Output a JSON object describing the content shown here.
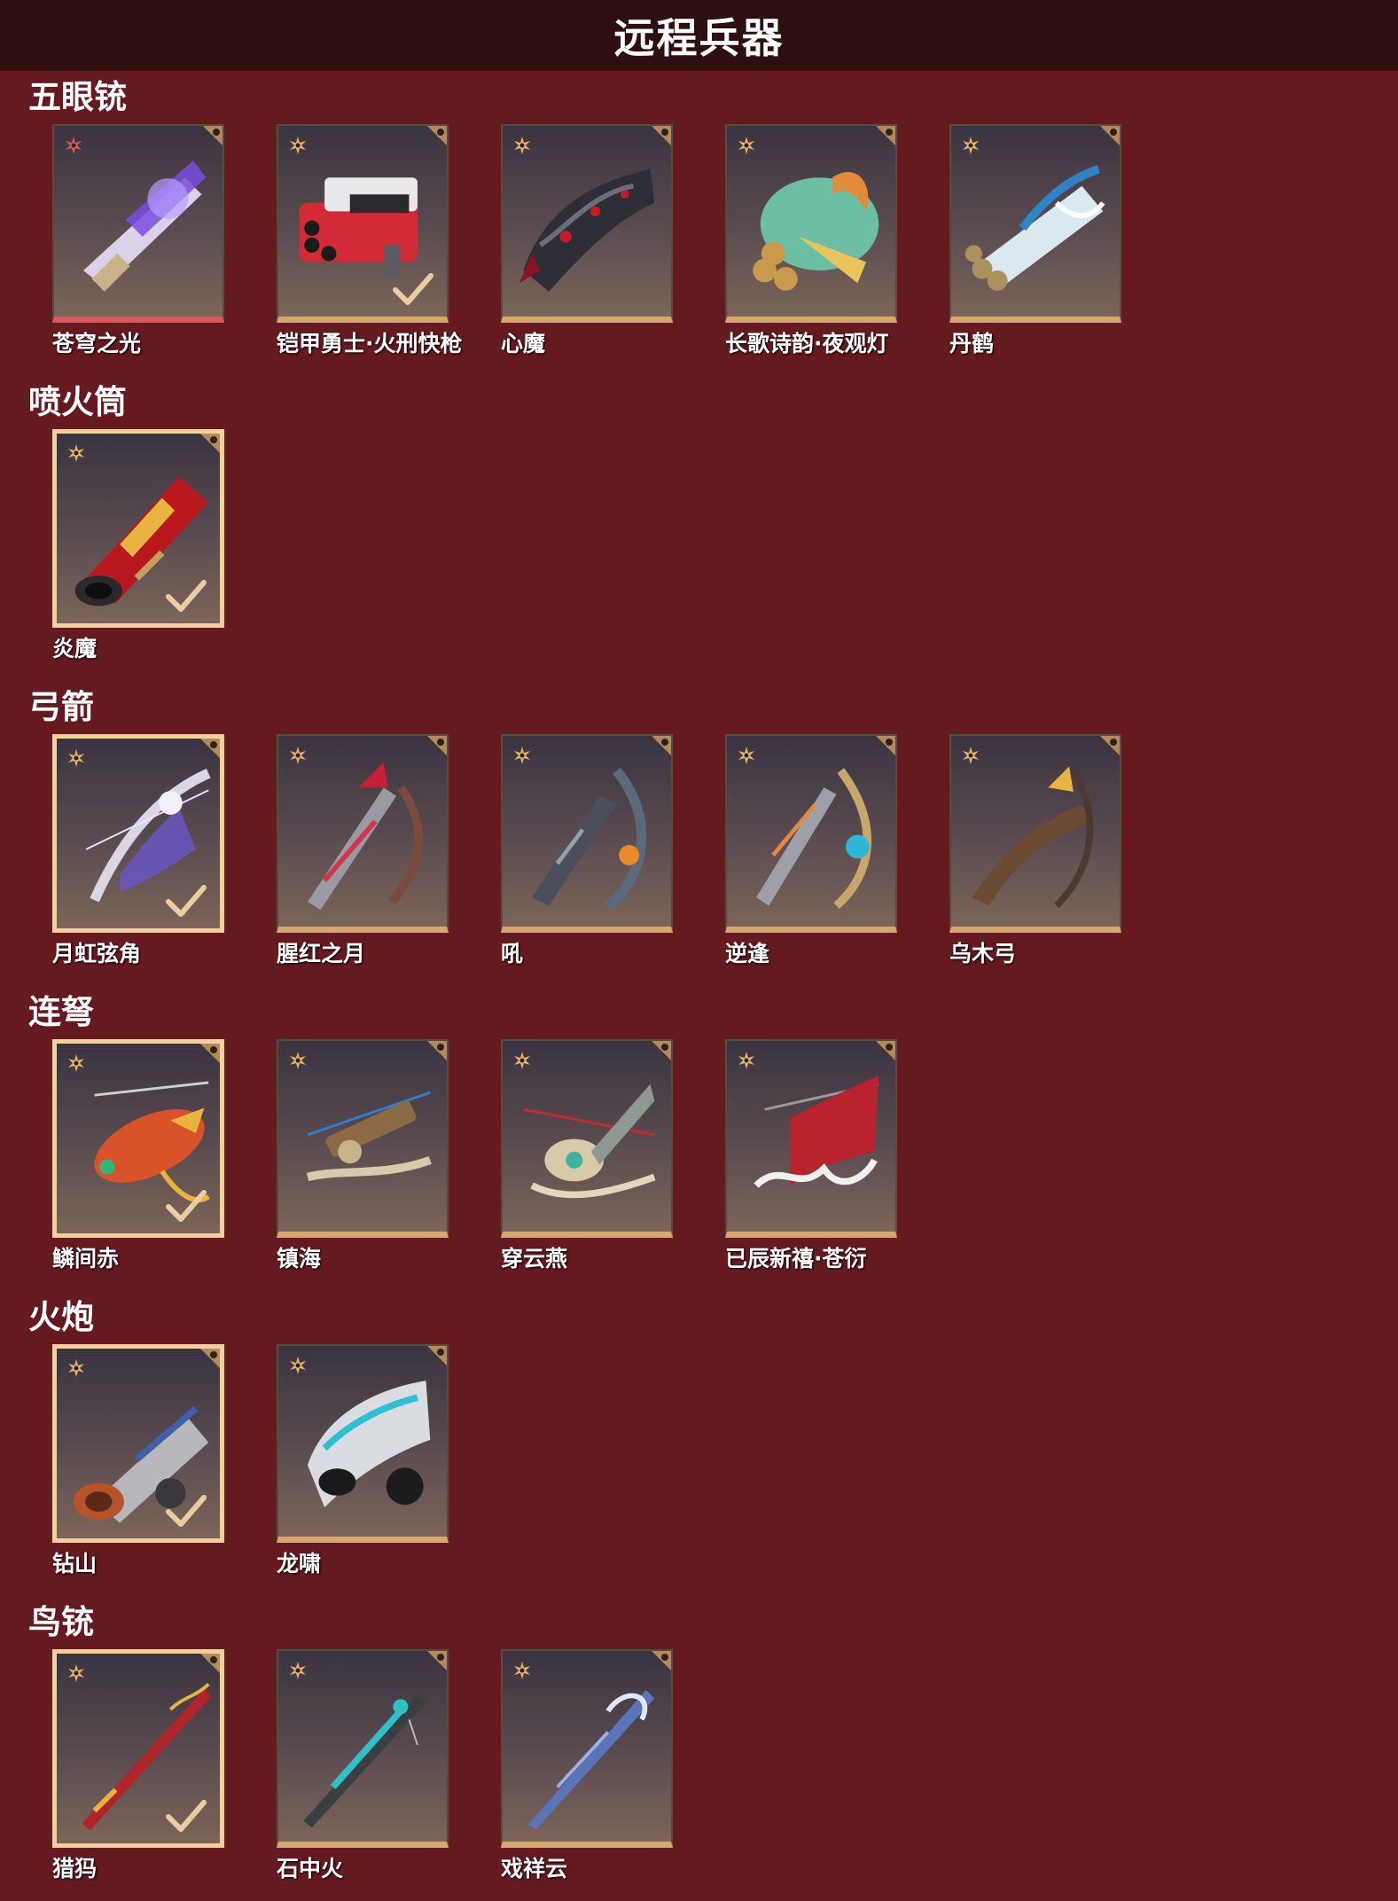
{
  "page_title": "远程兵器",
  "colors": {
    "background": "#641a1f",
    "header": "#2e0f10",
    "card_border_gold": "#d6a86d",
    "selected_border": "#f1d09e",
    "rarity_red": "#e1555f"
  },
  "sections": [
    {
      "title": "五眼铳",
      "items": [
        {
          "name": "苍穹之光",
          "selected": false,
          "rarity": "red",
          "checked": false,
          "art": "ornate-pistol-violet"
        },
        {
          "name": "铠甲勇士·火刑快枪",
          "selected": false,
          "rarity": "gold",
          "checked": true,
          "art": "red-multi-barrel-gun"
        },
        {
          "name": "心魔",
          "selected": false,
          "rarity": "gold",
          "checked": false,
          "art": "dark-tentacle-gun"
        },
        {
          "name": "长歌诗韵·夜观灯",
          "selected": false,
          "rarity": "gold",
          "checked": false,
          "art": "jade-fish-gun"
        },
        {
          "name": "丹鹤",
          "selected": false,
          "rarity": "gold",
          "checked": false,
          "art": "crane-cannon-gun"
        }
      ]
    },
    {
      "title": "喷火筒",
      "items": [
        {
          "name": "炎魔",
          "selected": true,
          "rarity": "gold",
          "checked": true,
          "art": "flame-tube"
        }
      ]
    },
    {
      "title": "弓箭",
      "items": [
        {
          "name": "月虹弦角",
          "selected": true,
          "rarity": "gold",
          "checked": true,
          "art": "moon-bow"
        },
        {
          "name": "腥红之月",
          "selected": false,
          "rarity": "gold",
          "checked": false,
          "art": "crimson-bow"
        },
        {
          "name": "吼",
          "selected": false,
          "rarity": "gold",
          "checked": false,
          "art": "roar-bow"
        },
        {
          "name": "逆逢",
          "selected": false,
          "rarity": "gold",
          "checked": false,
          "art": "cyan-bow"
        },
        {
          "name": "乌木弓",
          "selected": false,
          "rarity": "gold",
          "checked": false,
          "art": "ebony-bow"
        }
      ]
    },
    {
      "title": "连弩",
      "items": [
        {
          "name": "鳞间赤",
          "selected": true,
          "rarity": "gold",
          "checked": true,
          "art": "koi-crossbow"
        },
        {
          "name": "镇海",
          "selected": false,
          "rarity": "gold",
          "checked": false,
          "art": "sea-crossbow"
        },
        {
          "name": "穿云燕",
          "selected": false,
          "rarity": "gold",
          "checked": false,
          "art": "swallow-crossbow"
        },
        {
          "name": "已辰新禧·苍衍",
          "selected": false,
          "rarity": "gold",
          "checked": false,
          "art": "festive-crossbow"
        }
      ]
    },
    {
      "title": "火炮",
      "items": [
        {
          "name": "钻山",
          "selected": true,
          "rarity": "gold",
          "checked": true,
          "art": "silver-cannon"
        },
        {
          "name": "龙啸",
          "selected": false,
          "rarity": "gold",
          "checked": false,
          "art": "dragon-cannon"
        }
      ]
    },
    {
      "title": "鸟铳",
      "items": [
        {
          "name": "猎犸",
          "selected": true,
          "rarity": "gold",
          "checked": true,
          "art": "red-musket"
        },
        {
          "name": "石中火",
          "selected": false,
          "rarity": "gold",
          "checked": false,
          "art": "turquoise-musket"
        },
        {
          "name": "戏祥云",
          "selected": false,
          "rarity": "gold",
          "checked": false,
          "art": "cloud-musket"
        }
      ]
    }
  ]
}
